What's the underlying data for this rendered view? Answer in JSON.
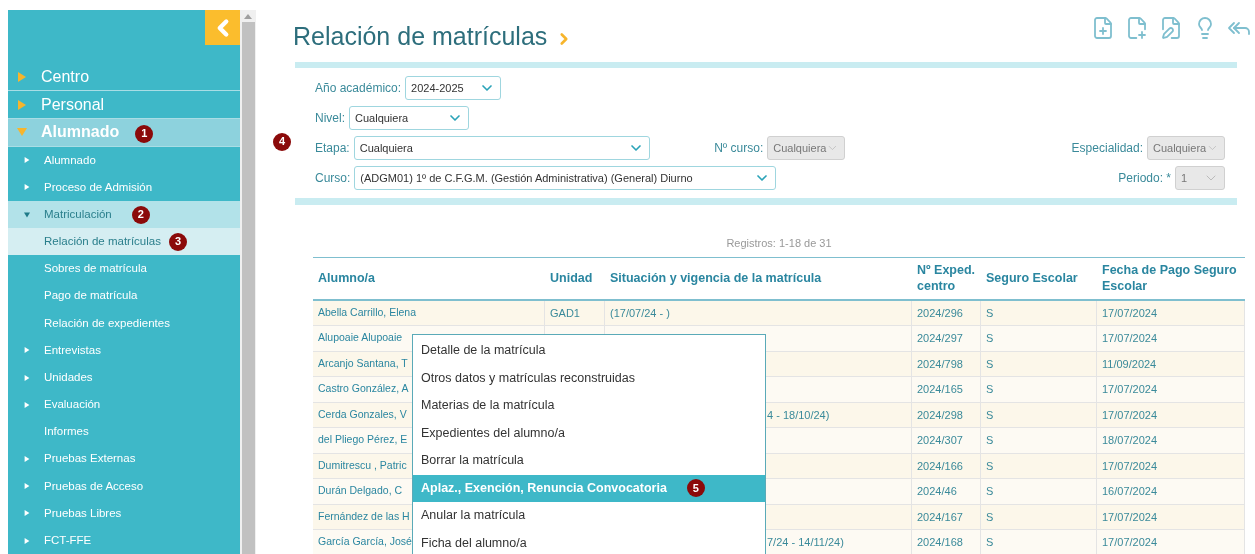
{
  "sidebar": {
    "items": [
      {
        "label": "Centro",
        "expanded": false,
        "selected": false
      },
      {
        "label": "Personal",
        "expanded": false,
        "selected": false
      },
      {
        "label": "Alumnado",
        "expanded": true,
        "selected": true,
        "badge": "1",
        "children": [
          {
            "label": "Alumnado",
            "expanded": false,
            "selected": false
          },
          {
            "label": "Proceso de Admisión",
            "expanded": false,
            "selected": false
          },
          {
            "label": "Matriculación",
            "expanded": true,
            "selected": true,
            "badge": "2",
            "children": [
              {
                "label": "Relación de matrículas",
                "selected": true,
                "badge": "3"
              },
              {
                "label": "Sobres de matrícula",
                "selected": false
              },
              {
                "label": "Pago de matrícula",
                "selected": false
              },
              {
                "label": "Relación de expedientes",
                "selected": false
              }
            ]
          },
          {
            "label": "Entrevistas",
            "expanded": false,
            "selected": false
          },
          {
            "label": "Unidades",
            "expanded": false,
            "selected": false
          },
          {
            "label": "Evaluación",
            "expanded": false,
            "selected": false
          },
          {
            "label": "Informes",
            "selected": false
          },
          {
            "label": "Pruebas Externas",
            "expanded": false,
            "selected": false
          },
          {
            "label": "Pruebas de Acceso",
            "expanded": false,
            "selected": false
          },
          {
            "label": "Pruebas Libres",
            "expanded": false,
            "selected": false
          },
          {
            "label": "FCT-FFE",
            "expanded": false,
            "selected": false
          }
        ]
      }
    ]
  },
  "page": {
    "title": "Relación de matrículas",
    "toolbar": [
      {
        "kind": "file-add"
      },
      {
        "kind": "file-new"
      },
      {
        "kind": "file-edit"
      },
      {
        "kind": "bulb"
      },
      {
        "kind": "reply-all"
      }
    ]
  },
  "filters": {
    "badge": "4",
    "rows": [
      [
        {
          "label": "Año académico:",
          "value": "2024-2025",
          "disabled": false
        },
        null,
        null
      ],
      [
        {
          "label": "Nivel:",
          "value": "Cualquiera",
          "disabled": false
        },
        null,
        null
      ],
      [
        {
          "label": "Etapa:",
          "value": "Cualquiera",
          "disabled": false
        },
        {
          "label": "Nº curso:",
          "value": "Cualquiera",
          "disabled": true
        },
        {
          "label": "Especialidad:",
          "value": "Cualquiera",
          "disabled": true
        }
      ],
      [
        {
          "label": "Curso:",
          "value": "(ADGM01) 1º de C.F.G.M. (Gestión Administrativa) (General) Diurno",
          "disabled": false
        },
        null,
        {
          "label": "Periodo: *",
          "value": "1",
          "disabled": true
        }
      ]
    ]
  },
  "table": {
    "records": "Registros: 1-18 de 31",
    "columns": [
      "Alumno/a",
      "Unidad",
      "Situación y vigencia de la matrícula",
      "Nº Exped. centro",
      "Seguro Escolar",
      "Fecha de Pago Seguro Escolar"
    ],
    "rows": [
      [
        "Abella Carrillo, Elena",
        "GAD1",
        "(17/07/24 - )",
        "2024/296",
        "S",
        "17/07/2024"
      ],
      [
        "Alupoaie Alupoaie",
        "",
        "",
        "2024/297",
        "S",
        "17/07/2024"
      ],
      [
        "Arcanjo Santana, T",
        "",
        "",
        "2024/798",
        "S",
        "11/09/2024"
      ],
      [
        "Castro González, A",
        "",
        "",
        "2024/165",
        "S",
        "17/07/2024"
      ],
      [
        "Cerda Gonzales, V",
        "",
        "4 - 18/10/24)",
        "2024/298",
        "S",
        "17/07/2024"
      ],
      [
        "del Pliego Pérez, E",
        "",
        "",
        "2024/307",
        "S",
        "18/07/2024"
      ],
      [
        "Dumitrescu , Patric",
        "",
        "",
        "2024/166",
        "S",
        "17/07/2024"
      ],
      [
        "Durán Delgado, C",
        "",
        "",
        "2024/46",
        "S",
        "16/07/2024"
      ],
      [
        "Fernández de las H",
        "",
        "",
        "2024/167",
        "S",
        "17/07/2024"
      ],
      [
        "García García, José",
        "",
        "7/24 - 14/11/24)",
        "2024/168",
        "S",
        "17/07/2024"
      ]
    ]
  },
  "context_menu": {
    "items": [
      {
        "label": "Detalle de la matrícula",
        "selected": false
      },
      {
        "label": "Otros datos y matrículas reconstruidas",
        "selected": false
      },
      {
        "label": "Materias de la matrícula",
        "selected": false
      },
      {
        "label": "Expedientes del alumno/a",
        "selected": false
      },
      {
        "label": "Borrar la matrícula",
        "selected": false
      },
      {
        "label": "Aplaz., Exención, Renuncia Convocatoria",
        "selected": true,
        "badge": "5"
      },
      {
        "label": "Anular la matrícula",
        "selected": false
      },
      {
        "label": "Ficha del alumno/a",
        "selected": false
      }
    ]
  }
}
